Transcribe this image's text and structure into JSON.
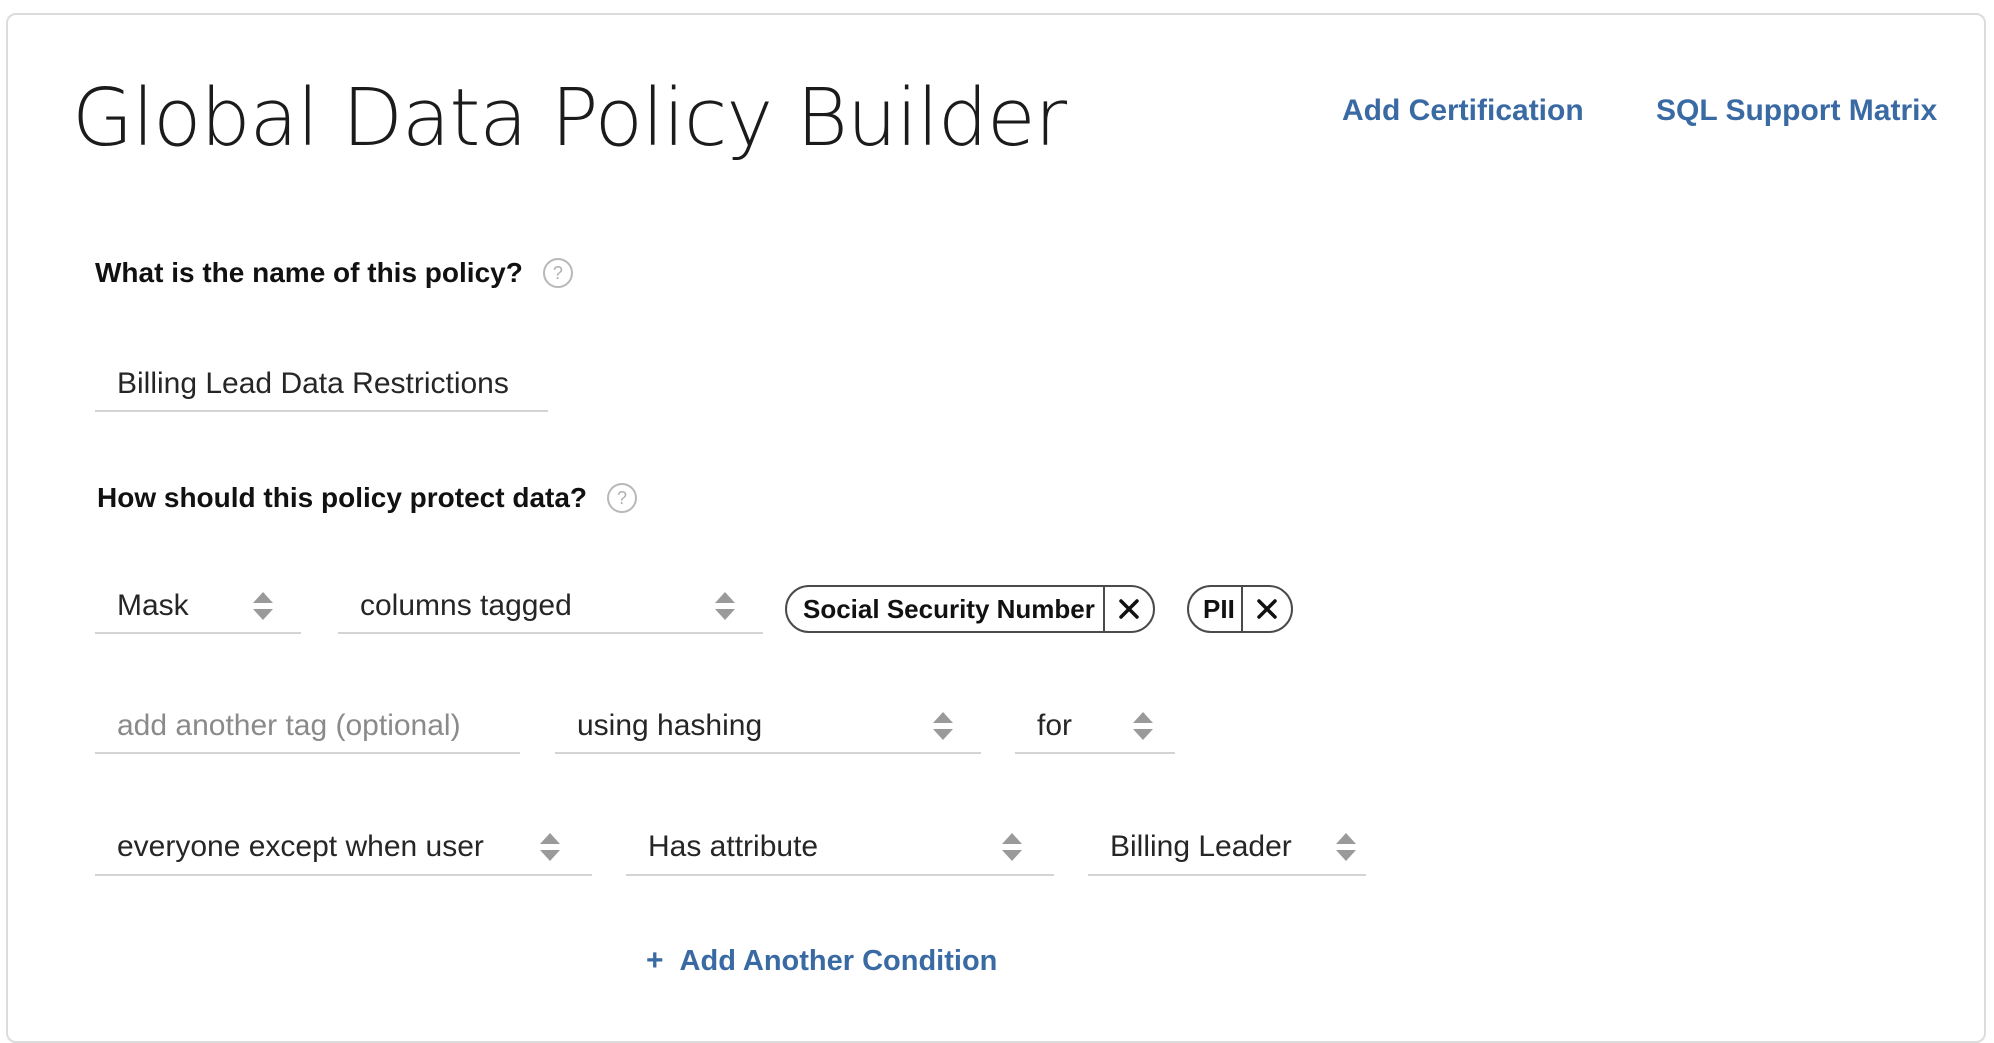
{
  "header": {
    "title": "Global Data Policy Builder",
    "links": {
      "add_certification": "Add Certification",
      "sql_support_matrix": "SQL Support Matrix"
    }
  },
  "policy_name": {
    "question": "What is the name of this policy?",
    "help_icon": "?",
    "value": "Billing Lead Data Restrictions"
  },
  "protection": {
    "question": "How should this policy protect data?",
    "help_icon": "?",
    "action": "Mask",
    "target": "columns tagged",
    "tags": [
      {
        "label": "Social Security Number"
      },
      {
        "label": "PII"
      }
    ],
    "tag_input_placeholder": "add another tag (optional)",
    "method": "using hashing",
    "scope_word": "for",
    "audience": "everyone except when user",
    "condition_type": "Has attribute",
    "condition_value": "Billing Leader",
    "add_condition": {
      "plus": "+",
      "label": "Add Another Condition"
    }
  },
  "colors": {
    "link": "#3a6aa3",
    "border": "#d4d4d4",
    "chip_border": "#4a4a4a"
  }
}
